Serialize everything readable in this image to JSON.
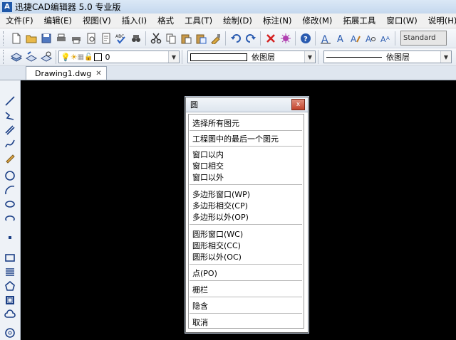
{
  "app": {
    "title": "迅捷CAD编辑器 5.0 专业版",
    "logo": "A"
  },
  "menu": [
    "文件(F)",
    "编辑(E)",
    "视图(V)",
    "插入(I)",
    "格式",
    "工具(T)",
    "绘制(D)",
    "标注(N)",
    "修改(M)",
    "拓展工具",
    "窗口(W)",
    "说明(H)"
  ],
  "toolbar": {
    "text_style": "Standard"
  },
  "layer_bar": {
    "layer_value": "0",
    "color_value": "依图层",
    "linetype_value": "依图层"
  },
  "tabs": {
    "document": "Drawing1.dwg",
    "close_glyph": "✕"
  },
  "dialog": {
    "title": "圆",
    "close_glyph": "x",
    "options": [
      "选择所有图元",
      "工程图中的最后一个图元",
      "窗口以内",
      "窗口相交",
      "窗口以外",
      "多边形窗口(WP)",
      "多边形相交(CP)",
      "多边形以外(OP)",
      "圆形窗口(WC)",
      "圆形相交(CC)",
      "圆形以外(OC)",
      "点(PO)",
      "栅栏",
      "隐含",
      "取消"
    ]
  },
  "colors": {
    "canvas": "#000000",
    "accent": "#1f58a8",
    "close_button": "#c2432b"
  }
}
